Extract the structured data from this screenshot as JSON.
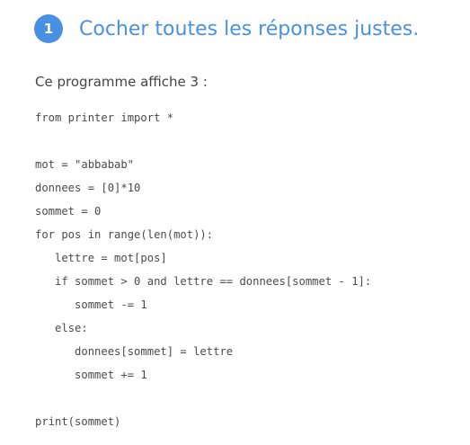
{
  "question": {
    "number": "1",
    "title": "Cocher toutes les réponses justes.",
    "prompt": "Ce programme affiche 3 :"
  },
  "code": {
    "lines": [
      "from printer import *",
      "",
      "mot = \"abbabab\"",
      "donnees = [0]*10",
      "sommet = 0",
      "for pos in range(len(mot)):",
      "   lettre = mot[pos]",
      "   if sommet > 0 and lettre == donnees[sommet - 1]:",
      "      sommet -= 1",
      "   else:",
      "      donnees[sommet] = lettre",
      "      sommet += 1",
      "",
      "print(sommet)"
    ]
  },
  "colors": {
    "accent": "#4a90e2",
    "text": "#444444"
  }
}
